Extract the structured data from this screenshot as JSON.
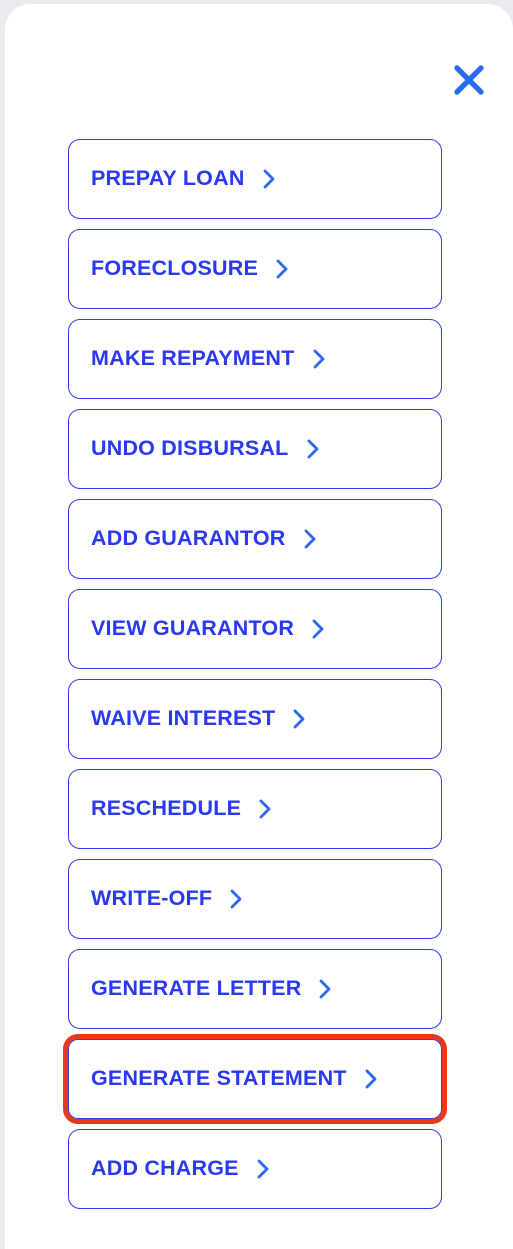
{
  "panel": {
    "close_label": "Close",
    "close_icon": "close-icon"
  },
  "colors": {
    "accent_blue": "#2A38F2",
    "chevron_blue": "#2A68EF",
    "highlight_red": "#E8371A",
    "panel_background": "#FFFFFF",
    "page_background": "#E9EAEE"
  },
  "actions": [
    {
      "label": "PREPAY LOAN",
      "name": "prepay-loan",
      "icon": "chevron-right-icon",
      "highlighted": false
    },
    {
      "label": "FORECLOSURE",
      "name": "foreclosure",
      "icon": "chevron-right-icon",
      "highlighted": false
    },
    {
      "label": "MAKE REPAYMENT",
      "name": "make-repayment",
      "icon": "chevron-right-icon",
      "highlighted": false
    },
    {
      "label": "UNDO DISBURSAL",
      "name": "undo-disbursal",
      "icon": "chevron-right-icon",
      "highlighted": false
    },
    {
      "label": "ADD GUARANTOR",
      "name": "add-guarantor",
      "icon": "chevron-right-icon",
      "highlighted": false
    },
    {
      "label": "VIEW GUARANTOR",
      "name": "view-guarantor",
      "icon": "chevron-right-icon",
      "highlighted": false
    },
    {
      "label": "WAIVE INTEREST",
      "name": "waive-interest",
      "icon": "chevron-right-icon",
      "highlighted": false
    },
    {
      "label": "RESCHEDULE",
      "name": "reschedule",
      "icon": "chevron-right-icon",
      "highlighted": false
    },
    {
      "label": "WRITE-OFF",
      "name": "write-off",
      "icon": "chevron-right-icon",
      "highlighted": false
    },
    {
      "label": "GENERATE LETTER",
      "name": "generate-letter",
      "icon": "chevron-right-icon",
      "highlighted": false
    },
    {
      "label": "GENERATE STATEMENT",
      "name": "generate-statement",
      "icon": "chevron-right-icon",
      "highlighted": true
    },
    {
      "label": "ADD CHARGE",
      "name": "add-charge",
      "icon": "chevron-right-icon",
      "highlighted": false
    }
  ]
}
